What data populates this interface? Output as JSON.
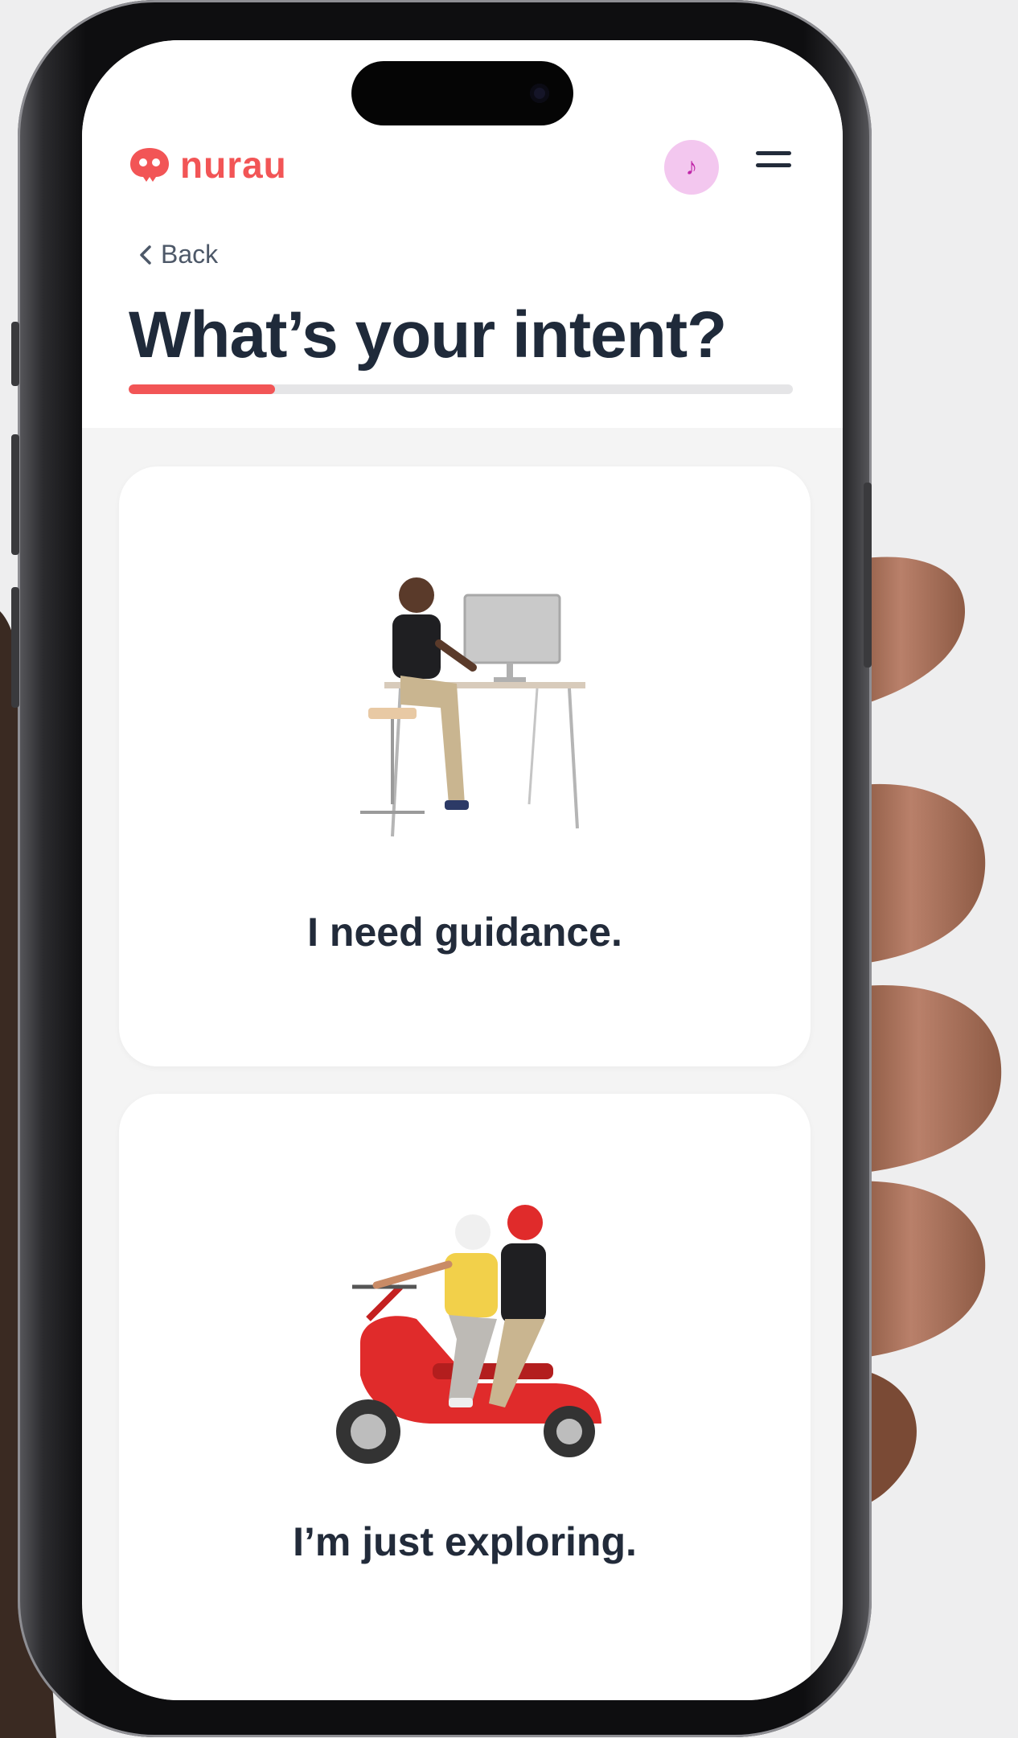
{
  "app": {
    "logo_text": "nurau",
    "brand_color": "#f25556",
    "avatar_icon": "music-note-icon",
    "menu_icon": "hamburger-menu-icon"
  },
  "nav": {
    "back_label": "Back",
    "back_icon": "chevron-left-icon"
  },
  "page": {
    "title": "What’s your intent?",
    "progress_fraction": 0.22
  },
  "options": [
    {
      "label": "I need guidance.",
      "illustration": "person-at-desk-illustration"
    },
    {
      "label": "I’m just exploring.",
      "illustration": "couple-on-scooter-illustration"
    }
  ]
}
